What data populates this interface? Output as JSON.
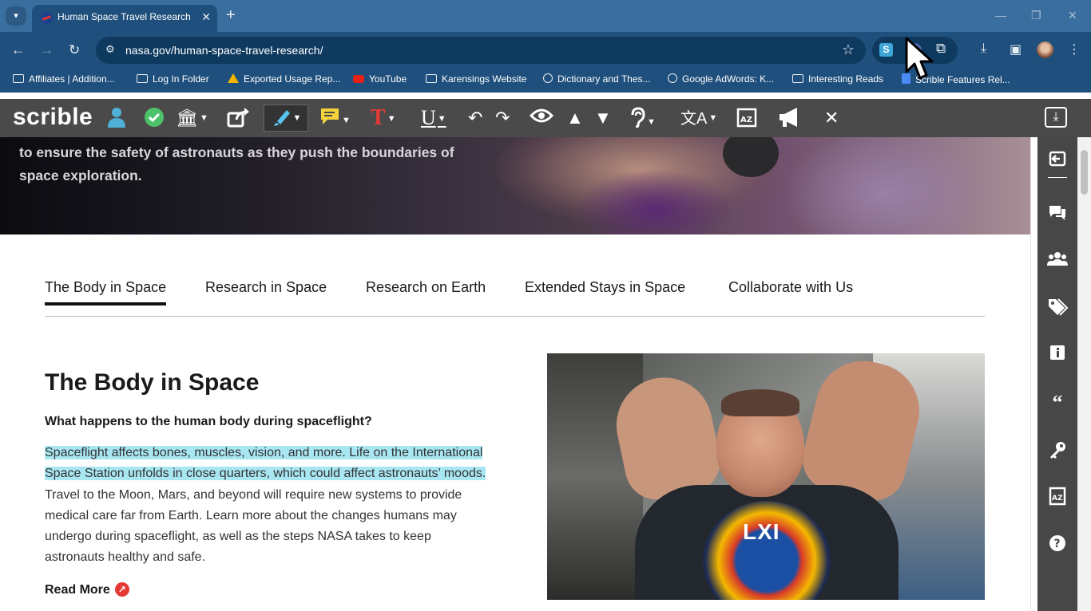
{
  "browser": {
    "tab_title": "Human Space Travel Research -",
    "url": "nasa.gov/human-space-travel-research/",
    "bookmarks": [
      {
        "label": "Affiliates | Addition...",
        "icon": "folder-icon"
      },
      {
        "label": "Log In Folder",
        "icon": "folder-icon"
      },
      {
        "label": "Exported Usage Rep...",
        "icon": "drive-icon"
      },
      {
        "label": "YouTube",
        "icon": "youtube-icon"
      },
      {
        "label": "Karensings Website",
        "icon": "folder-icon"
      },
      {
        "label": "Dictionary and Thes...",
        "icon": "globe-icon"
      },
      {
        "label": "Google AdWords: K...",
        "icon": "globe-icon"
      },
      {
        "label": "Interesting Reads",
        "icon": "folder-icon"
      },
      {
        "label": "Scrible Features Rel...",
        "icon": "doc-icon"
      }
    ],
    "colors": {
      "chrome": "#1f4f7c",
      "tabbar": "#3a6e9e"
    }
  },
  "scrible": {
    "logo": "scrible",
    "toolbar_icons": [
      "user-icon",
      "check-icon",
      "library-icon",
      "share-icon",
      "highlighter-icon",
      "note-icon",
      "text-color-icon",
      "underline-icon",
      "undo-icon",
      "redo-icon",
      "eye-icon",
      "up-icon",
      "down-icon",
      "listen-icon",
      "translate-icon",
      "dictionary-icon",
      "announce-icon",
      "close-icon",
      "download-icon"
    ],
    "sidebar_icons": [
      "collapse-icon",
      "comments-icon",
      "groups-icon",
      "tags-icon",
      "info-icon",
      "quote-icon",
      "key-icon",
      "dictionary-icon",
      "help-icon"
    ],
    "colors": {
      "toolbar": "#4a4a4a",
      "highlight": "#a8e6f2"
    }
  },
  "hero": {
    "text": "to ensure the safety of astronauts as they push the boundaries of space exploration."
  },
  "tabs": [
    {
      "label": "The Body in Space",
      "active": true
    },
    {
      "label": "Research in Space",
      "active": false
    },
    {
      "label": "Research on Earth",
      "active": false
    },
    {
      "label": "Extended Stays in Space",
      "active": false
    },
    {
      "label": "Collaborate with Us",
      "active": false
    }
  ],
  "section": {
    "title": "The Body in Space",
    "question": "What happens to the human body during spaceflight?",
    "body_highlighted": "Spaceflight affects bones, muscles, vision, and more. Life on the International Space Station unfolds in close quarters, which could affect astronauts’ moods.",
    "body_rest": " Travel to the Moon, Mars, and beyond will require new systems to provide medical care far from Earth. Learn more about the changes humans may undergo during spaceflight, as well as the steps NASA takes to keep astronauts healthy and safe.",
    "read_more": "Read More",
    "photo_patch_text": "LXI"
  }
}
